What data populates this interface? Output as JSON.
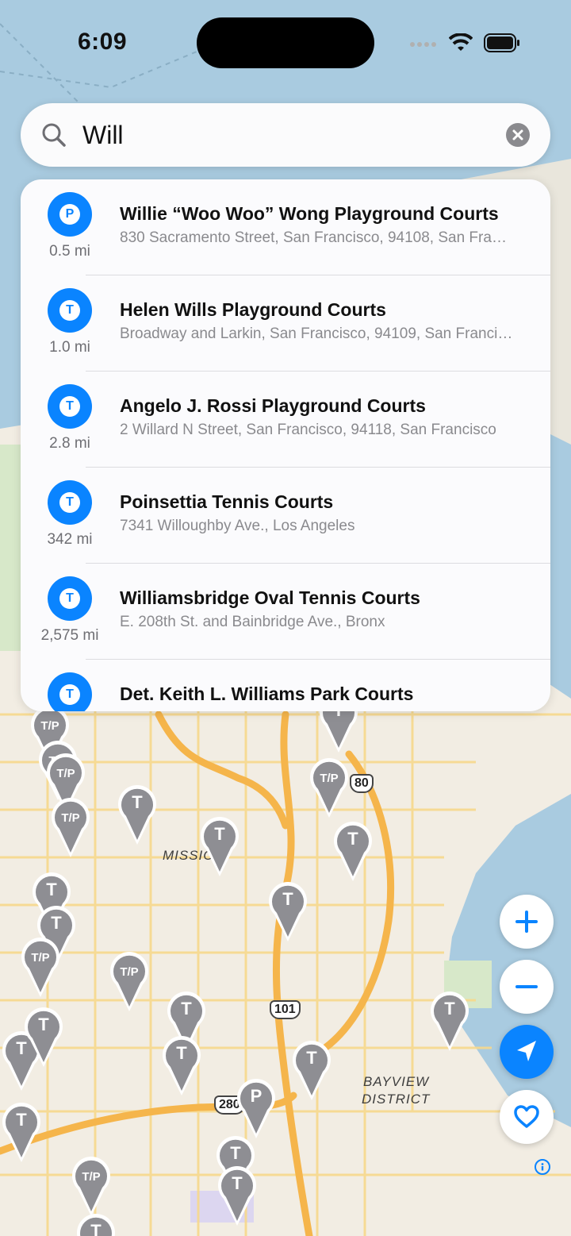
{
  "status": {
    "time": "6:09"
  },
  "search": {
    "value": "Will"
  },
  "results": [
    {
      "icon": "P",
      "title": "Willie “Woo Woo” Wong Playground Courts",
      "subtitle": "830 Sacramento Street, San Francisco, 94108, San Francisco",
      "distance": "0.5 mi"
    },
    {
      "icon": "T",
      "title": "Helen Wills Playground Courts",
      "subtitle": "Broadway and Larkin, San Francisco, 94109, San Francisco",
      "distance": "1.0 mi"
    },
    {
      "icon": "T",
      "title": "Angelo J. Rossi Playground Courts",
      "subtitle": "2 Willard N Street, San Francisco, 94118, San Francisco",
      "distance": "2.8 mi"
    },
    {
      "icon": "T",
      "title": "Poinsettia Tennis Courts",
      "subtitle": "7341 Willoughby Ave., Los Angeles",
      "distance": "342 mi"
    },
    {
      "icon": "T",
      "title": "Williamsbridge Oval Tennis Courts",
      "subtitle": "E. 208th St. and Bainbridge Ave., Bronx",
      "distance": "2,575 mi"
    },
    {
      "icon": "T",
      "title": "Det. Keith L. Williams Park Courts",
      "subtitle": "",
      "distance": ""
    }
  ],
  "map": {
    "labels": {
      "mission": "MISSIO",
      "bayview_1": "BAYVIEW",
      "bayview_2": "DISTRICT"
    },
    "shields": {
      "us101": "101",
      "i280": "280",
      "i80": "80"
    },
    "pin_labels": [
      "T/P",
      "T/P",
      "T/P",
      "T/P",
      "T",
      "T",
      "T",
      "T",
      "T",
      "T/P",
      "T",
      "T",
      "T/P",
      "T/P",
      "T",
      "T",
      "T",
      "T",
      "T",
      "P",
      "T",
      "T",
      "T/P",
      "T",
      "T",
      "T"
    ]
  },
  "controls": {
    "zoom_in": "+",
    "zoom_out": "−"
  },
  "colors": {
    "accent": "#0a84ff",
    "water": "#a9cbe0",
    "land": "#f2ede3",
    "pin": "#8e8e93"
  }
}
